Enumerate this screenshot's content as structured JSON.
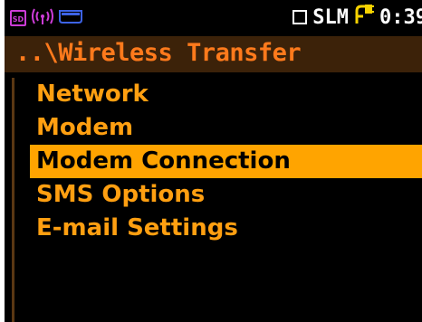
{
  "status_bar": {
    "sd_label": "SD",
    "mode": "SLM",
    "time": "0:39",
    "icons": [
      "sd-card-icon",
      "antenna-icon",
      "battery-icon",
      "square-indicator-icon",
      "external-power-icon"
    ]
  },
  "title": "..\\Wireless Transfer",
  "menu": {
    "items": [
      {
        "label": "Network",
        "selected": false
      },
      {
        "label": "Modem",
        "selected": false
      },
      {
        "label": "Modem Connection",
        "selected": true
      },
      {
        "label": "SMS Options",
        "selected": false
      },
      {
        "label": "E-mail Settings",
        "selected": false
      }
    ]
  },
  "colors": {
    "background": "#000000",
    "title_bar": "#3c2209",
    "title_text": "#ff7a1c",
    "menu_text": "#ff9f11",
    "selection": "#ffa400"
  }
}
